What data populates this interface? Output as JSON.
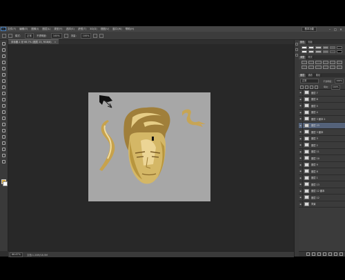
{
  "menubar": {
    "items": [
      "文件(F)",
      "编辑(E)",
      "图像(I)",
      "图层(L)",
      "类型(Y)",
      "选择(S)",
      "滤镜(T)",
      "3D(D)",
      "视图(V)",
      "窗口(W)",
      "帮助(H)"
    ],
    "workspace": "基本功能",
    "logo": "Ps"
  },
  "optionsbar": {
    "mode_label": "模式：",
    "mode_value": "正常",
    "opacity_label": "不透明度：",
    "opacity_value": "100%",
    "flow_label": "流量：",
    "flow_value": "100%"
  },
  "document_tab": {
    "title": "未标题-1 @ 66.7% (图层 23, RGB/8)",
    "close": "×"
  },
  "statusbar": {
    "zoom": "66.67%",
    "doc_info": "文档:1.20M/18.5M"
  },
  "panels": {
    "color_tabs": [
      "颜色",
      "色板"
    ],
    "adjust_tabs": [
      "调整",
      "样式"
    ],
    "layers_tabs": [
      "图层",
      "通道",
      "路径"
    ],
    "blend_mode": "正常",
    "opacity_label": "不透明度：",
    "opacity_value": "100%",
    "fill_label": "填充：",
    "fill_value": "100%",
    "layers": [
      {
        "name": "图层 7",
        "selected": false
      },
      {
        "name": "图层 6",
        "selected": false
      },
      {
        "name": "图层 5",
        "selected": false
      },
      {
        "name": "图层 4",
        "selected": false
      },
      {
        "name": "图层 3 副本 2",
        "selected": false
      },
      {
        "name": "图层 23",
        "selected": true
      },
      {
        "name": "图层 3 副本",
        "selected": false
      },
      {
        "name": "图层 3",
        "selected": false
      },
      {
        "name": "图层 2",
        "selected": false
      },
      {
        "name": "图层 11",
        "selected": false
      },
      {
        "name": "图层 10",
        "selected": false
      },
      {
        "name": "图层 9",
        "selected": false
      },
      {
        "name": "图层 8",
        "selected": false
      },
      {
        "name": "图层 1",
        "selected": false
      },
      {
        "name": "图层 13",
        "selected": false
      },
      {
        "name": "图层 12 副本",
        "selected": false
      },
      {
        "name": "图层 12",
        "selected": false
      },
      {
        "name": "背景",
        "selected": false
      }
    ]
  },
  "colors": {
    "foreground": "#d9a83a",
    "background": "#ffffff",
    "canvas_bg": "#a7a7a7",
    "workspace_bg": "#282828"
  }
}
